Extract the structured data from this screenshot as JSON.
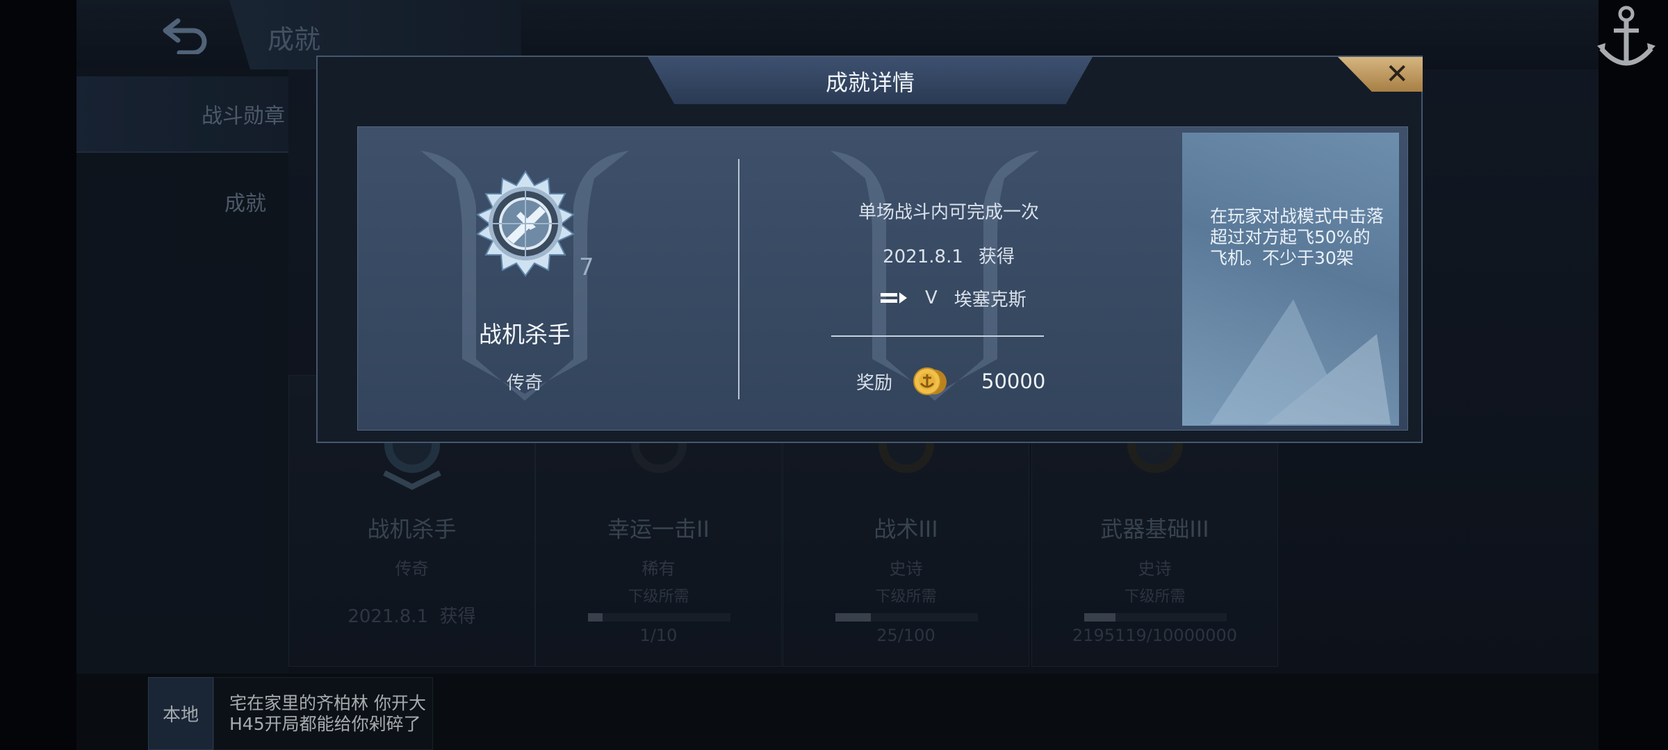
{
  "page": {
    "title": "成就",
    "sidebar": [
      {
        "label": "战斗勋章"
      },
      {
        "label": "成就"
      }
    ]
  },
  "cards": [
    {
      "title": "战机杀手",
      "rarity": "传奇",
      "date": "2021.8.1",
      "date_suffix": "获得"
    },
    {
      "title": "幸运一击II",
      "rarity": "稀有",
      "next_label": "下级所需",
      "progress_text": "1/10",
      "progress": 0.1
    },
    {
      "title": "战术III",
      "rarity": "史诗",
      "next_label": "下级所需",
      "progress_text": "25/100",
      "progress": 0.25
    },
    {
      "title": "武器基础III",
      "rarity": "史诗",
      "next_label": "下级所需",
      "progress_text": "2195119/10000000",
      "progress": 0.22
    }
  ],
  "modal": {
    "title": "成就详情",
    "close_label": "✕",
    "medal_level": "7",
    "name": "战机杀手",
    "rarity": "传奇",
    "condition": "单场战斗内可完成一次",
    "date": "2021.8.1",
    "date_suffix": "获得",
    "ship_tier": "V",
    "ship_name": "埃塞克斯",
    "reward_label": "奖励",
    "reward_amount": "50000",
    "description": "在玩家对战模式中击落超过对方起飞50%的飞机。不少于30架"
  },
  "chat": {
    "channel": "本地",
    "message": "宅在家里的齐柏林 你开大H45开局都能给你剁碎了"
  },
  "icons": {
    "back": "back-arrow-icon",
    "anchor": "anchor-icon",
    "medal": "fighter-medal-icon",
    "ship": "ship-icon",
    "coin": "gold-coin-icon",
    "close": "close-icon"
  },
  "colors": {
    "modal_header": "#33465f",
    "close_button": "#c49f63",
    "desc_panel": "#6b8bab"
  }
}
